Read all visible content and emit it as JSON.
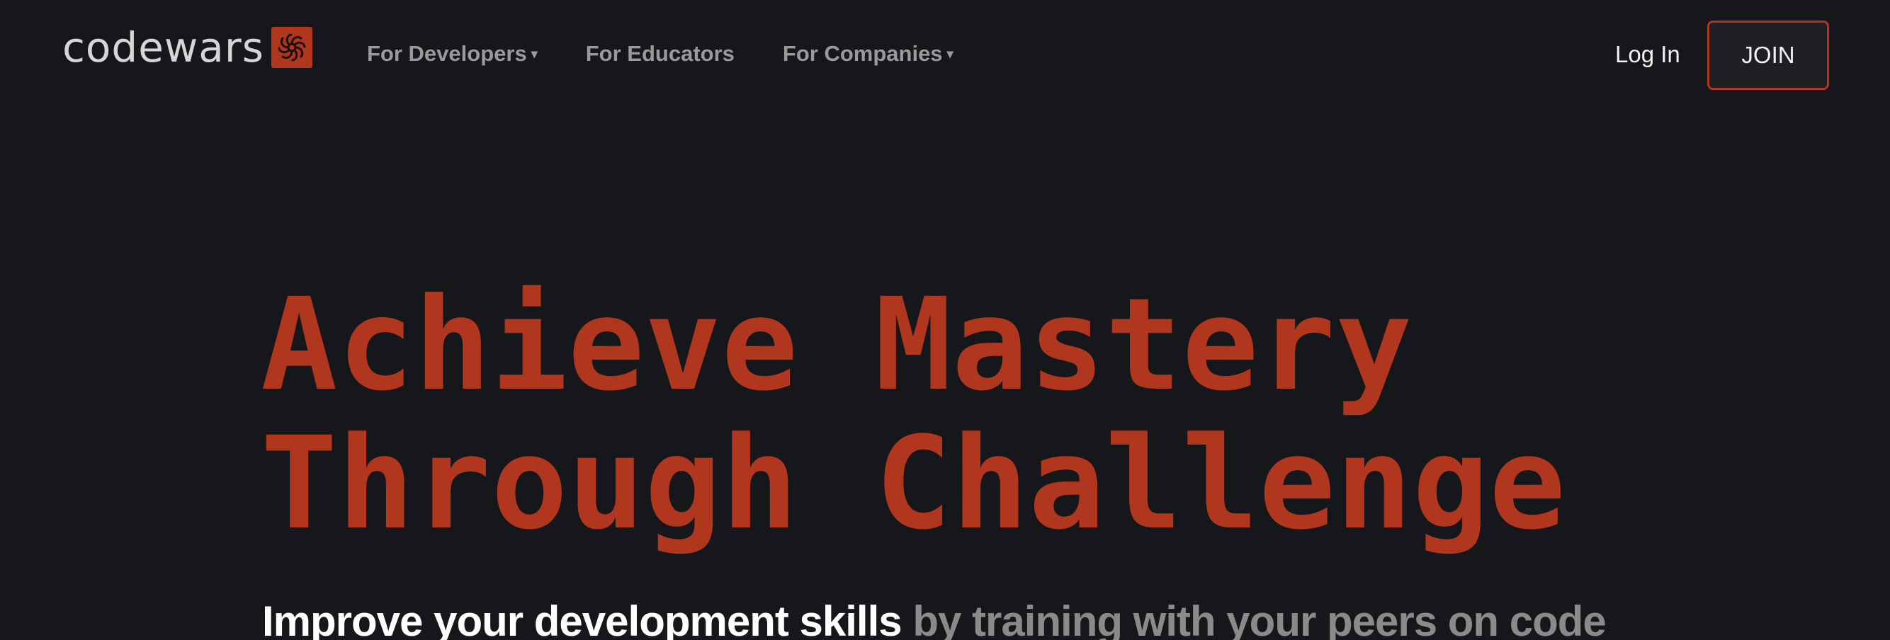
{
  "brand": {
    "name": "codewars",
    "accent_color": "#b1361e"
  },
  "nav": {
    "items": [
      {
        "label": "For Developers",
        "has_dropdown": true
      },
      {
        "label": "For Educators",
        "has_dropdown": false
      },
      {
        "label": "For Companies",
        "has_dropdown": true
      }
    ],
    "dropdown_glyph": "▾",
    "login_label": "Log In",
    "join_label": "JOIN"
  },
  "hero": {
    "title_line1": "Achieve Mastery",
    "title_line2": "Through Challenge",
    "subtitle_strong": "Improve your development skills",
    "subtitle_muted": "by training with your peers on code"
  },
  "colors": {
    "background": "#16171b",
    "text_primary": "#ffffff",
    "text_muted": "#8a8a8a"
  }
}
